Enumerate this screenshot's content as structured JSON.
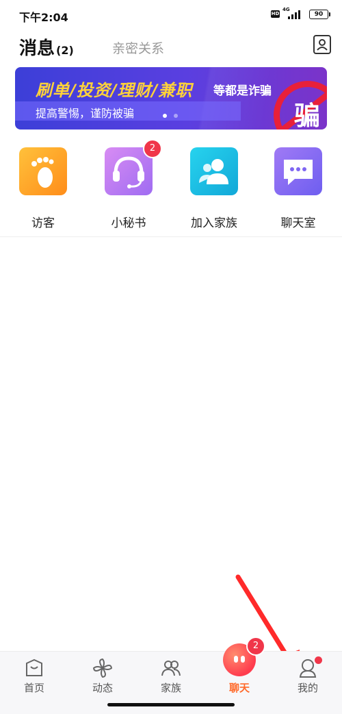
{
  "status_bar": {
    "time": "下午2:04",
    "hd": "HD",
    "network": "4G",
    "battery": "90"
  },
  "header": {
    "tab_messages": "消息",
    "tab_messages_count": "(2)",
    "tab_relations": "亲密关系"
  },
  "banner": {
    "headline": "刷单/投资/理财/兼职",
    "subtitle": "等都是诈骗",
    "tagline": "提高警惕，谨防被骗",
    "seal_char": "骗",
    "colors": {
      "background": "#4a3fdc",
      "headline": "#ffd23a",
      "seal": "#e8203a"
    }
  },
  "shortcuts": [
    {
      "label": "访客",
      "icon": "footprint-icon",
      "color": "#ffa820"
    },
    {
      "label": "小秘书",
      "icon": "headset-icon",
      "color": "#c17cf0",
      "badge": "2"
    },
    {
      "label": "加入家族",
      "icon": "people-icon",
      "color": "#1bc8e6"
    },
    {
      "label": "聊天室",
      "icon": "chat-bubble-icon",
      "color": "#8a6ef3"
    }
  ],
  "bottom_nav": [
    {
      "label": "首页",
      "icon": "home-icon"
    },
    {
      "label": "动态",
      "icon": "pinwheel-icon"
    },
    {
      "label": "家族",
      "icon": "group-icon"
    },
    {
      "label": "聊天",
      "icon": "chat-icon",
      "active": true,
      "badge": "2"
    },
    {
      "label": "我的",
      "icon": "profile-icon",
      "dot": true
    }
  ],
  "colors": {
    "accent": "#ff6a2b",
    "badge": "#f0364a"
  }
}
